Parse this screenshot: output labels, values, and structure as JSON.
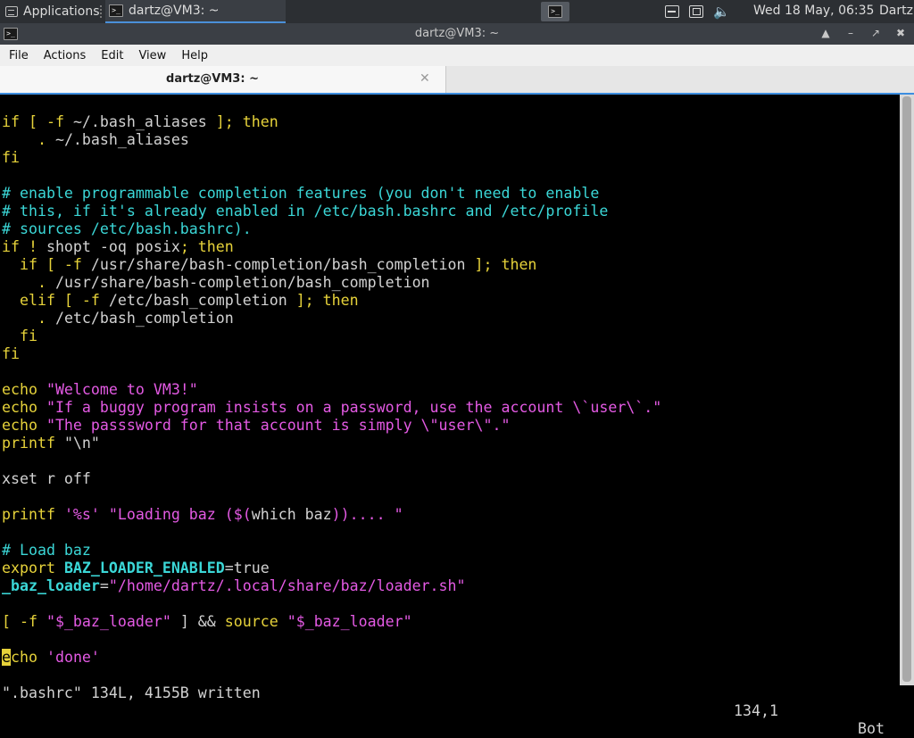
{
  "panel": {
    "applications_label": "Applications",
    "task_title": "dartz@VM3: ~",
    "clock": "Wed 18 May, 06:35",
    "user": "Dartz",
    "launcher_icon": "terminal-icon",
    "tray_icons": [
      "disk-icon",
      "network-icon",
      "volume-icon"
    ]
  },
  "window": {
    "title": "dartz@VM3: ~",
    "buttons": [
      "maximize-up",
      "minimize",
      "restore",
      "close"
    ]
  },
  "menu": {
    "items": [
      "File",
      "Actions",
      "Edit",
      "View",
      "Help"
    ]
  },
  "tabs": [
    {
      "label": "dartz@VM3: ~",
      "active": true
    }
  ],
  "editor": {
    "lines": [
      [
        [
          "if [ -f ",
          "c-y"
        ],
        [
          "~/.bash_aliases",
          "c-w"
        ],
        [
          " ]; then",
          "c-y"
        ]
      ],
      [
        [
          "    . ",
          "c-y"
        ],
        [
          "~/.bash_aliases",
          "c-w"
        ]
      ],
      [
        [
          "fi",
          "c-y"
        ]
      ],
      [],
      [
        [
          "# enable programmable completion features (you don't need to enable",
          "c-c"
        ]
      ],
      [
        [
          "# this, if it's already enabled in /etc/bash.bashrc and /etc/profile",
          "c-c"
        ]
      ],
      [
        [
          "# sources /etc/bash.bashrc).",
          "c-c"
        ]
      ],
      [
        [
          "if ! ",
          "c-y"
        ],
        [
          "shopt -oq posix",
          "c-w"
        ],
        [
          "; then",
          "c-y"
        ]
      ],
      [
        [
          "  if [ -f ",
          "c-y"
        ],
        [
          "/usr/share/bash-completion/bash_completion",
          "c-w"
        ],
        [
          " ]; then",
          "c-y"
        ]
      ],
      [
        [
          "    . ",
          "c-y"
        ],
        [
          "/usr/share/bash-completion/bash_completion",
          "c-w"
        ]
      ],
      [
        [
          "  elif [ -f ",
          "c-y"
        ],
        [
          "/etc/bash_completion",
          "c-w"
        ],
        [
          " ]; then",
          "c-y"
        ]
      ],
      [
        [
          "    . ",
          "c-y"
        ],
        [
          "/etc/bash_completion",
          "c-w"
        ]
      ],
      [
        [
          "  fi",
          "c-y"
        ]
      ],
      [
        [
          "fi",
          "c-y"
        ]
      ],
      [],
      [
        [
          "echo ",
          "c-y"
        ],
        [
          "\"Welcome to VM3!\"",
          "c-m"
        ]
      ],
      [
        [
          "echo ",
          "c-y"
        ],
        [
          "\"If a buggy program insists on a password, use the account \\`user\\`.\"",
          "c-m"
        ]
      ],
      [
        [
          "echo ",
          "c-y"
        ],
        [
          "\"The passsword for that account is simply \\\"user\\\".\"",
          "c-m"
        ]
      ],
      [
        [
          "printf ",
          "c-y"
        ],
        [
          "\"\\n\"",
          "c-w"
        ]
      ],
      [],
      [
        [
          "xset r off",
          "c-w"
        ]
      ],
      [],
      [
        [
          "printf ",
          "c-y"
        ],
        [
          "'%s' \"Loading baz ($(",
          "c-m"
        ],
        [
          "which baz",
          "c-w"
        ],
        [
          ")).... \"",
          "c-m"
        ]
      ],
      [],
      [
        [
          "# Load baz",
          "c-c"
        ]
      ],
      [
        [
          "export ",
          "c-y"
        ],
        [
          "BAZ_LOADER_ENABLED",
          "c-cb"
        ],
        [
          "=true",
          "c-w"
        ]
      ],
      [
        [
          "_baz_loader",
          "c-cb"
        ],
        [
          "=",
          "c-w"
        ],
        [
          "\"/home/dartz/.local/share/baz/loader.sh\"",
          "c-m"
        ]
      ],
      [],
      [
        [
          "[ -f ",
          "c-y"
        ],
        [
          "\"$_baz_loader\"",
          "c-m"
        ],
        [
          " ] && ",
          "c-w"
        ],
        [
          "source ",
          "c-y"
        ],
        [
          "\"$_baz_loader\"",
          "c-m"
        ]
      ],
      [],
      [
        [
          "e",
          "cursor"
        ],
        [
          "cho ",
          "c-y"
        ],
        [
          "'done'",
          "c-m"
        ]
      ]
    ],
    "status_message": "\".bashrc\" 134L, 4155B written",
    "cursor_position": "134,1",
    "scroll_position": "Bot"
  }
}
